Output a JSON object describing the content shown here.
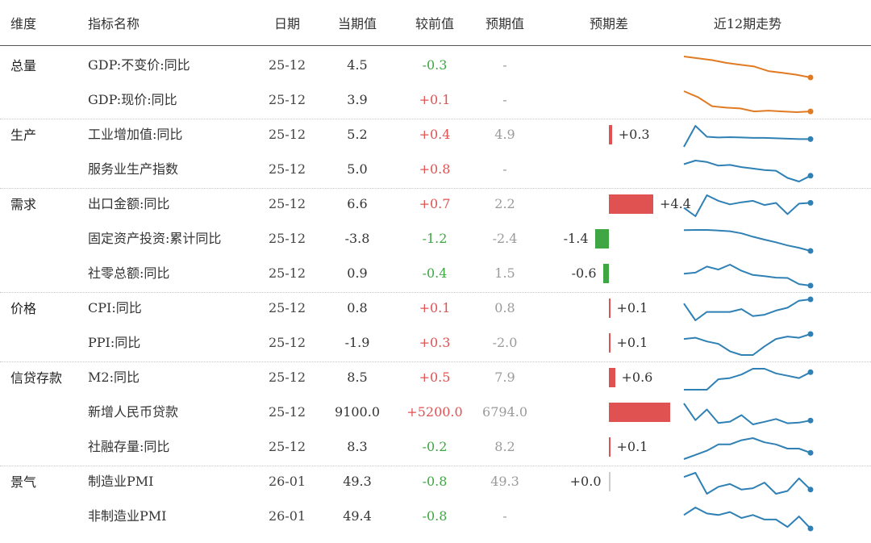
{
  "headers": {
    "dimension": "维度",
    "indicator": "指标名称",
    "date": "日期",
    "current": "当期值",
    "change": "较前值",
    "forecast": "预期值",
    "gap": "预期差",
    "trend": "近12期走势"
  },
  "groups": [
    {
      "label": "总量",
      "color": "#e07b24",
      "rows": [
        {
          "name": "GDP:不变价:同比",
          "date": "25-12",
          "current": "4.5",
          "change": "-0.3",
          "forecast": "-",
          "gap": null,
          "gap_label": "",
          "trend": [
            6.8,
            6.6,
            6.4,
            6.1,
            5.9,
            5.7,
            5.2,
            5.0,
            4.8,
            4.5
          ]
        },
        {
          "name": "GDP:现价:同比",
          "date": "25-12",
          "current": "3.9",
          "change": "+0.1",
          "forecast": "-",
          "gap": null,
          "gap_label": "",
          "trend": [
            6.6,
            5.8,
            4.6,
            4.4,
            4.3,
            3.9,
            4.0,
            3.9,
            3.8,
            3.9
          ]
        }
      ]
    },
    {
      "label": "生产",
      "color": "#2f80b4",
      "rows": [
        {
          "name": "工业增加值:同比",
          "date": "25-12",
          "current": "5.2",
          "change": "+0.4",
          "forecast": "4.9",
          "gap": 0.3,
          "gap_label": "+0.3",
          "trend": [
            3.2,
            8.6,
            5.8,
            5.6,
            5.7,
            5.6,
            5.5,
            5.5,
            5.4,
            5.3,
            5.2,
            5.2
          ]
        },
        {
          "name": "服务业生产指数",
          "date": "25-12",
          "current": "5.0",
          "change": "+0.8",
          "forecast": "-",
          "gap": null,
          "gap_label": "",
          "trend": [
            6.6,
            7.1,
            6.9,
            6.4,
            6.5,
            6.2,
            6.0,
            5.8,
            5.7,
            4.7,
            4.2,
            5.0
          ]
        }
      ]
    },
    {
      "label": "需求",
      "color": "#2f80b4",
      "rows": [
        {
          "name": "出口金额:同比",
          "date": "25-12",
          "current": "6.6",
          "change": "+0.7",
          "forecast": "2.2",
          "gap": 4.4,
          "gap_label": "+4.4",
          "trend": [
            3.0,
            -3.0,
            12.0,
            8.0,
            5.5,
            7.0,
            8.0,
            5.0,
            6.5,
            -1.5,
            6.0,
            6.6
          ]
        },
        {
          "name": "固定资产投资:累计同比",
          "date": "25-12",
          "current": "-3.8",
          "change": "-1.2",
          "forecast": "-2.4",
          "gap": -1.4,
          "gap_label": "-1.4",
          "trend": [
            4.1,
            4.2,
            4.2,
            4.0,
            3.7,
            2.9,
            1.6,
            0.5,
            -0.5,
            -1.7,
            -2.6,
            -3.8
          ]
        },
        {
          "name": "社零总额:同比",
          "date": "25-12",
          "current": "0.9",
          "change": "-0.4",
          "forecast": "1.5",
          "gap": -0.6,
          "gap_label": "-0.6",
          "trend": [
            4.0,
            4.3,
            5.9,
            5.1,
            6.4,
            4.8,
            3.7,
            3.4,
            3.0,
            2.9,
            1.3,
            0.9
          ]
        }
      ]
    },
    {
      "label": "价格",
      "color": "#2f80b4",
      "rows": [
        {
          "name": "CPI:同比",
          "date": "25-12",
          "current": "0.8",
          "change": "+0.1",
          "forecast": "0.8",
          "gap": 0.1,
          "gap_label": "+0.1",
          "trend": [
            0.5,
            -0.7,
            -0.1,
            -0.1,
            -0.1,
            0.1,
            -0.4,
            -0.3,
            0.0,
            0.2,
            0.7,
            0.8
          ]
        },
        {
          "name": "PPI:同比",
          "date": "25-12",
          "current": "-1.9",
          "change": "+0.3",
          "forecast": "-2.0",
          "gap": 0.1,
          "gap_label": "+0.1",
          "trend": [
            -2.3,
            -2.2,
            -2.5,
            -2.7,
            -3.3,
            -3.6,
            -3.6,
            -2.9,
            -2.3,
            -2.1,
            -2.2,
            -1.9
          ]
        }
      ]
    },
    {
      "label": "信贷存款",
      "color": "#2f80b4",
      "rows": [
        {
          "name": "M2:同比",
          "date": "25-12",
          "current": "8.5",
          "change": "+0.5",
          "forecast": "7.9",
          "gap": 0.6,
          "gap_label": "+0.6",
          "trend": [
            7.0,
            7.0,
            7.0,
            7.9,
            8.0,
            8.3,
            8.8,
            8.8,
            8.4,
            8.2,
            8.0,
            8.5
          ]
        },
        {
          "name": "新增人民币贷款",
          "date": "25-12",
          "current": "9100.0",
          "change": "+5200.0",
          "forecast": "6794.0",
          "gap": 2306.0,
          "gap_label": "",
          "trend": [
            51300,
            10100,
            36400,
            2800,
            6200,
            22400,
            -500,
            5900,
            12900,
            2200,
            3900,
            9100
          ]
        },
        {
          "name": "社融存量:同比",
          "date": "25-12",
          "current": "8.3",
          "change": "-0.2",
          "forecast": "8.2",
          "gap": 0.1,
          "gap_label": "+0.1",
          "trend": [
            8.0,
            8.2,
            8.4,
            8.7,
            8.7,
            8.9,
            9.0,
            8.8,
            8.7,
            8.5,
            8.5,
            8.3
          ]
        }
      ]
    },
    {
      "label": "景气",
      "color": "#2f80b4",
      "rows": [
        {
          "name": "制造业PMI",
          "date": "26-01",
          "current": "49.3",
          "change": "-0.8",
          "forecast": "49.3",
          "gap": 0.0,
          "gap_label": "+0.0",
          "trend": [
            50.2,
            50.5,
            49.0,
            49.5,
            49.7,
            49.3,
            49.4,
            49.8,
            49.0,
            49.2,
            50.1,
            49.3
          ]
        },
        {
          "name": "非制造业PMI",
          "date": "26-01",
          "current": "49.4",
          "change": "-0.8",
          "forecast": "-",
          "gap": null,
          "gap_label": "",
          "trend": [
            50.3,
            50.8,
            50.4,
            50.3,
            50.5,
            50.1,
            50.3,
            50.0,
            50.0,
            49.5,
            50.2,
            49.4
          ]
        }
      ]
    }
  ],
  "colors": {
    "positive": "#e05252",
    "negative": "#3fa644",
    "muted": "#9a9a9a",
    "line_orange": "#e07b24",
    "line_blue": "#2f80b4",
    "text": "#333333"
  },
  "chart_data": {
    "type": "table",
    "columns": [
      "维度",
      "指标名称",
      "日期",
      "当期值",
      "较前值",
      "预期值",
      "预期差",
      "近12期走势"
    ],
    "rows": [
      [
        "总量",
        "GDP:不变价:同比",
        "25-12",
        4.5,
        -0.3,
        null,
        null
      ],
      [
        "总量",
        "GDP:现价:同比",
        "25-12",
        3.9,
        0.1,
        null,
        null
      ],
      [
        "生产",
        "工业增加值:同比",
        "25-12",
        5.2,
        0.4,
        4.9,
        0.3
      ],
      [
        "生产",
        "服务业生产指数",
        "25-12",
        5.0,
        0.8,
        null,
        null
      ],
      [
        "需求",
        "出口金额:同比",
        "25-12",
        6.6,
        0.7,
        2.2,
        4.4
      ],
      [
        "需求",
        "固定资产投资:累计同比",
        "25-12",
        -3.8,
        -1.2,
        -2.4,
        -1.4
      ],
      [
        "需求",
        "社零总额:同比",
        "25-12",
        0.9,
        -0.4,
        1.5,
        -0.6
      ],
      [
        "价格",
        "CPI:同比",
        "25-12",
        0.8,
        0.1,
        0.8,
        0.1
      ],
      [
        "价格",
        "PPI:同比",
        "25-12",
        -1.9,
        0.3,
        -2.0,
        0.1
      ],
      [
        "信贷存款",
        "M2:同比",
        "25-12",
        8.5,
        0.5,
        7.9,
        0.6
      ],
      [
        "信贷存款",
        "新增人民币贷款",
        "25-12",
        9100.0,
        5200.0,
        6794.0,
        2306.0
      ],
      [
        "信贷存款",
        "社融存量:同比",
        "25-12",
        8.3,
        -0.2,
        8.2,
        0.1
      ],
      [
        "景气",
        "制造业PMI",
        "26-01",
        49.3,
        -0.8,
        49.3,
        0.0
      ],
      [
        "景气",
        "非制造业PMI",
        "26-01",
        49.4,
        -0.8,
        null,
        null
      ]
    ]
  }
}
